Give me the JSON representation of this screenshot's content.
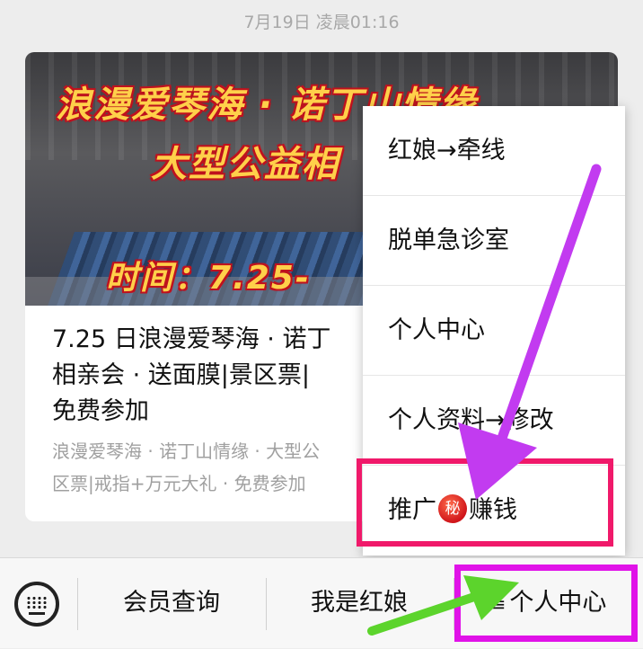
{
  "timestamp": "7月19日 凌晨01:16",
  "article": {
    "banner_line1": "浪漫爱琴海 · 诺丁山情缘",
    "banner_line2": "大型公益相",
    "banner_line3": "时间：7.25-",
    "title_line1": "7.25 日浪漫爱琴海 · 诺丁",
    "title_line2": "相亲会 · 送面膜|景区票|",
    "title_line3": "免费参加",
    "desc_line1": "浪漫爱琴海 · 诺丁山情缘 · 大型公",
    "desc_line2": "区票|戒指+万元大礼 · 免费参加"
  },
  "menu": {
    "items": [
      {
        "label": "红娘→牵线"
      },
      {
        "label": "脱单急诊室"
      },
      {
        "label": "个人中心"
      },
      {
        "label": "个人资料→修改"
      }
    ],
    "promo": {
      "prefix": "推广",
      "badge": "秘",
      "suffix": "赚钱"
    }
  },
  "bottom_bar": {
    "tabs": [
      {
        "label": "会员查询"
      },
      {
        "label": "我是红娘"
      },
      {
        "label": "个人中心",
        "prefix": "≡"
      }
    ]
  },
  "colors": {
    "highlight_pink": "#f0196a",
    "highlight_magenta": "#e012e8",
    "arrow_purple": "#c23bf0",
    "arrow_green": "#5cd42c"
  }
}
